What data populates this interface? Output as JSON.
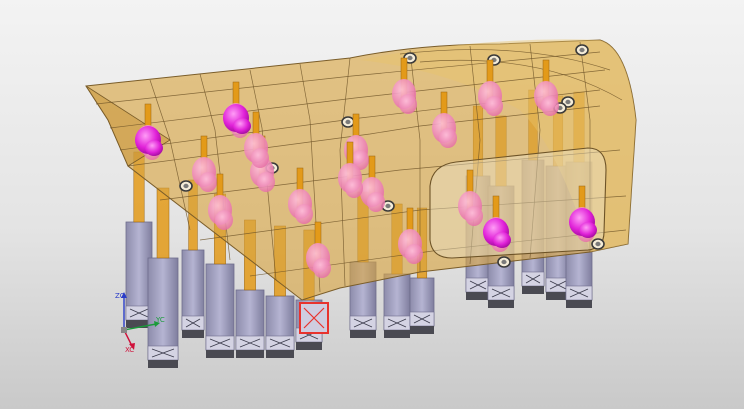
{
  "viewport": {
    "background_top": "#f3f3f3",
    "background_bottom": "#c9c9c9"
  },
  "model": {
    "skin_fill": "#d9a441",
    "skin_stroke": "#7a5d2a",
    "column_fill": "#a7a6c4",
    "column_dark": "#6e6d8c",
    "foot_fill": "#4a4a52",
    "clamp_arm": "#e39a19",
    "clamp_pad": "#ee82b4",
    "clamp_knob": "#e021d8",
    "selection_highlight": "#e8332e"
  },
  "triad": {
    "x_label": "XC",
    "y_label": "YC",
    "z_label": "ZC",
    "x_color": "#d0103a",
    "y_color": "#1a9b3a",
    "z_color": "#2a3cc8"
  }
}
